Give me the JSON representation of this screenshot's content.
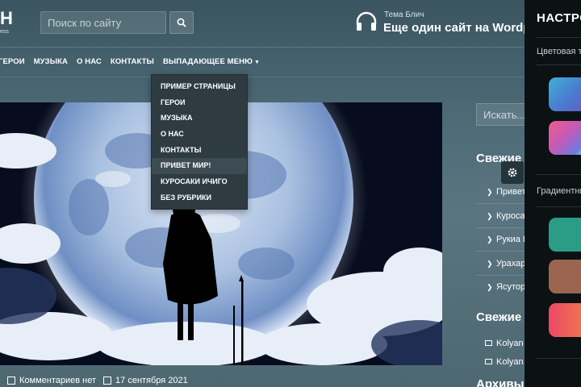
{
  "header": {
    "logo_text": "H",
    "logo_sub": "ess",
    "search_placeholder": "Поиск по сайту",
    "site_tagline": "Тема Блич",
    "site_title": "Еще один сайт на Wordpress"
  },
  "nav": {
    "items": [
      "Герои",
      "Музыка",
      "О нас",
      "Контакты",
      "Выпадающее меню"
    ]
  },
  "dropdown": {
    "items": [
      "Пример страницы",
      "Герои",
      "Музыка",
      "О нас",
      "Контакты",
      "Привет мир!",
      "Куросаки Ичиго",
      "Без рубрики"
    ],
    "highlighted_index": 5
  },
  "post_meta": {
    "comments": "Комментариев нет",
    "date": "17 сентября 2021"
  },
  "sidebar": {
    "search_placeholder": "Искать...",
    "recent_posts_title": "Свежие записи",
    "recent_posts": [
      "Привет мир!",
      "Куросаки Ичиго",
      "Рукиа Кучики",
      "Урахара",
      "Ясутора"
    ],
    "recent_comments_title": "Свежие комментарии",
    "recent_comments": [
      "Kolyan",
      "Kolyan"
    ],
    "archives_title": "Архивы"
  },
  "settings_panel": {
    "title": "НАСТРОЙКИ",
    "color_scheme_label": "Цветовая тема",
    "gradient_label": "Градиентные",
    "swatch_colors": [
      "#4a7bd0",
      "#c45ab8",
      "#2a9d86",
      "#9b6550",
      "#e84a5e"
    ]
  },
  "icons": {
    "search": "search-icon",
    "headphones": "headphones-icon",
    "gear": "gear-icon",
    "comment": "comment-icon",
    "calendar": "calendar-icon",
    "chevron": "chevron-right-icon"
  }
}
